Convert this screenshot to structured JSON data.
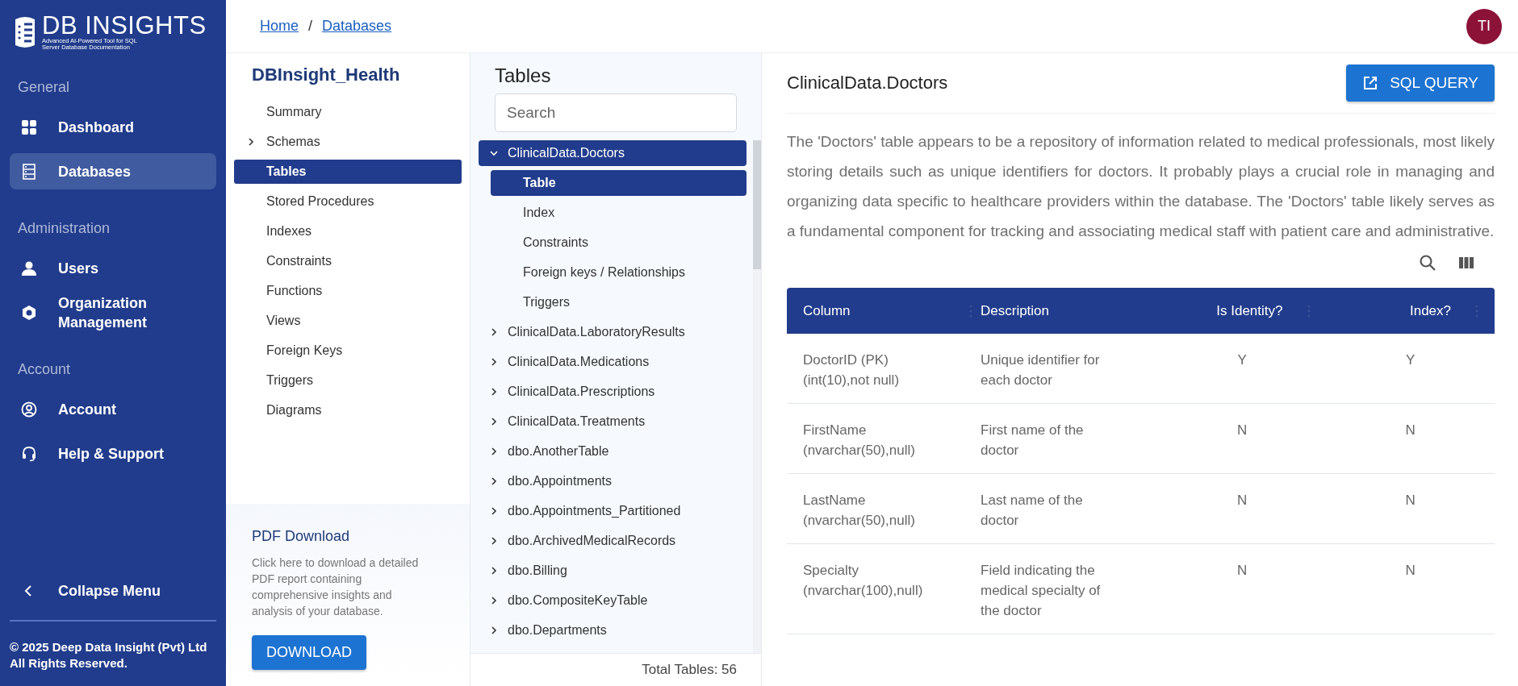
{
  "brand": {
    "title": "DB INSIGHTS",
    "subtitle": "Advanced AI-Powered Tool for SQL Server Database Documentation"
  },
  "sidebar": {
    "sections": [
      {
        "heading": "General",
        "items": [
          {
            "label": "Dashboard",
            "selected": false
          },
          {
            "label": "Databases",
            "selected": true
          }
        ]
      },
      {
        "heading": "Administration",
        "items": [
          {
            "label": "Users",
            "selected": false
          },
          {
            "label": "Organization Management",
            "selected": false
          }
        ]
      },
      {
        "heading": "Account",
        "items": [
          {
            "label": "Account",
            "selected": false
          },
          {
            "label": "Help & Support",
            "selected": false
          }
        ]
      }
    ],
    "collapse": "Collapse Menu",
    "footer": [
      "© 2025 Deep Data Insight (Pvt) Ltd",
      "All Rights Reserved."
    ]
  },
  "breadcrumb": {
    "separator": "/",
    "items": [
      {
        "label": "Home"
      },
      {
        "label": "Databases"
      }
    ]
  },
  "avatar": {
    "initials": "TI"
  },
  "database_panel": {
    "title": "DBInsight_Health",
    "items": [
      {
        "label": "Summary",
        "expandable": false,
        "selected": false
      },
      {
        "label": "Schemas",
        "expandable": true,
        "selected": false
      },
      {
        "label": "Tables",
        "expandable": false,
        "selected": true
      },
      {
        "label": "Stored Procedures",
        "expandable": false,
        "selected": false
      },
      {
        "label": "Indexes",
        "expandable": false,
        "selected": false
      },
      {
        "label": "Constraints",
        "expandable": false,
        "selected": false
      },
      {
        "label": "Functions",
        "expandable": false,
        "selected": false
      },
      {
        "label": "Views",
        "expandable": false,
        "selected": false
      },
      {
        "label": "Foreign Keys",
        "expandable": false,
        "selected": false
      },
      {
        "label": "Triggers",
        "expandable": false,
        "selected": false
      },
      {
        "label": "Diagrams",
        "expandable": false,
        "selected": false
      }
    ],
    "pdf_card": {
      "title": "PDF Download",
      "text": "Click here to download a detailed PDF report containing comprehensive insights and analysis of your database.",
      "button": "DOWNLOAD"
    }
  },
  "tables_panel": {
    "title": "Tables",
    "search": {
      "placeholder": "Search"
    },
    "tree": [
      {
        "label": "ClinicalData.Doctors",
        "expanded": true,
        "selected": true,
        "children": [
          {
            "label": "Table",
            "selected": true
          },
          {
            "label": "Index",
            "selected": false
          },
          {
            "label": "Constraints",
            "selected": false
          },
          {
            "label": "Foreign keys / Relationships",
            "selected": false
          },
          {
            "label": "Triggers",
            "selected": false
          }
        ]
      },
      {
        "label": "ClinicalData.LaboratoryResults",
        "expanded": false,
        "selected": false
      },
      {
        "label": "ClinicalData.Medications",
        "expanded": false,
        "selected": false
      },
      {
        "label": "ClinicalData.Prescriptions",
        "expanded": false,
        "selected": false
      },
      {
        "label": "ClinicalData.Treatments",
        "expanded": false,
        "selected": false
      },
      {
        "label": "dbo.AnotherTable",
        "expanded": false,
        "selected": false
      },
      {
        "label": "dbo.Appointments",
        "expanded": false,
        "selected": false
      },
      {
        "label": "dbo.Appointments_Partitioned",
        "expanded": false,
        "selected": false
      },
      {
        "label": "dbo.ArchivedMedicalRecords",
        "expanded": false,
        "selected": false
      },
      {
        "label": "dbo.Billing",
        "expanded": false,
        "selected": false
      },
      {
        "label": "dbo.CompositeKeyTable",
        "expanded": false,
        "selected": false
      },
      {
        "label": "dbo.Departments",
        "expanded": false,
        "selected": false
      }
    ],
    "total": "Total Tables: 56"
  },
  "detail": {
    "title": "ClinicalData.Doctors",
    "button": "SQL QUERY",
    "description": "The 'Doctors' table appears to be a repository of information related to medical professionals, most likely storing details such as unique identifiers for doctors. It probably plays a crucial role in managing and organizing data specific to healthcare providers within the database. The 'Doctors' table likely serves as a fundamental component for tracking and associating medical staff with patient care and administrative.",
    "table": {
      "columns": [
        "Column",
        "Description",
        "Is Identity?",
        "Index?"
      ],
      "rows": [
        [
          "DoctorID (PK)\n(int(10),not null)",
          "Unique identifier for\neach doctor",
          "Y",
          "Y"
        ],
        [
          "FirstName\n(nvarchar(50),null)",
          "First name of the\ndoctor",
          "N",
          "N"
        ],
        [
          "LastName\n(nvarchar(50),null)",
          "Last name of the\ndoctor",
          "N",
          "N"
        ],
        [
          "Specialty\n(nvarchar(100),null)",
          "Field indicating the\nmedical specialty of\nthe doctor",
          "N",
          "N"
        ]
      ]
    }
  }
}
